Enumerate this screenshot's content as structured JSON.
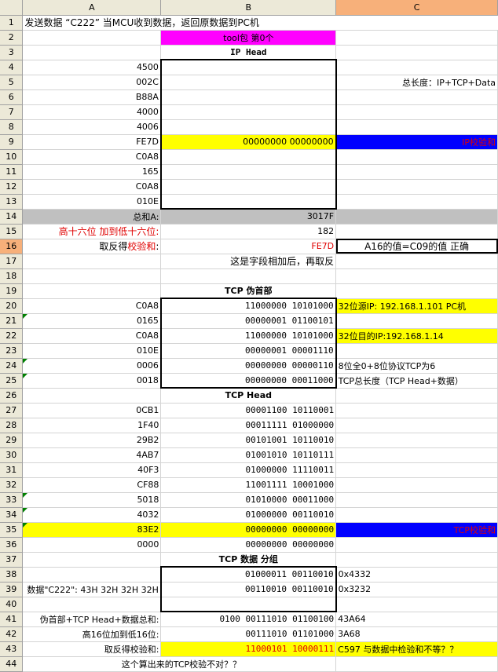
{
  "columns": [
    "A",
    "B",
    "C"
  ],
  "rows": {
    "r1": {
      "n": "1",
      "a": "发送数据 “C222” 当MCU收到数据，返回原数据到PC机"
    },
    "r2": {
      "n": "2",
      "b": "tool包 第0个"
    },
    "r3": {
      "n": "3",
      "b": "IP Head"
    },
    "r4": {
      "n": "4",
      "a": "4500"
    },
    "r5": {
      "n": "5",
      "a": "002C",
      "c": "总长度：IP+TCP+Data"
    },
    "r6": {
      "n": "6",
      "a": "B88A"
    },
    "r7": {
      "n": "7",
      "a": "4000"
    },
    "r8": {
      "n": "8",
      "a": "4006"
    },
    "r9": {
      "n": "9",
      "a": "FE7D",
      "b": "00000000 00000000",
      "c": "IP校验和"
    },
    "r10": {
      "n": "10",
      "a": "C0A8"
    },
    "r11": {
      "n": "11",
      "a": "165"
    },
    "r12": {
      "n": "12",
      "a": "C0A8"
    },
    "r13": {
      "n": "13",
      "a": "010E"
    },
    "r14": {
      "n": "14",
      "a": "总和A:",
      "b": "3017F"
    },
    "r15": {
      "n": "15",
      "a": "高十六位 加到低十六位:",
      "b": "182"
    },
    "r16": {
      "n": "16",
      "a1": "取反得",
      "a2": "校验和",
      "a3": ":",
      "b": "FE7D",
      "c": "A16的值=C09的值 正确"
    },
    "r17": {
      "n": "17",
      "b": "这是字段相加后，再取反"
    },
    "r18": {
      "n": "18"
    },
    "r19": {
      "n": "19",
      "b": "TCP 伪首部"
    },
    "r20": {
      "n": "20",
      "a": "C0A8",
      "b": "11000000 10101000",
      "c": "32位源IP: 192.168.1.101 PC机"
    },
    "r21": {
      "n": "21",
      "a": "0165",
      "b": "00000001 01100101"
    },
    "r22": {
      "n": "22",
      "a": "C0A8",
      "b": "11000000 10101000",
      "c": "32位目的IP:192.168.1.14"
    },
    "r23": {
      "n": "23",
      "a": "010E",
      "b": "00000001 00001110"
    },
    "r24": {
      "n": "24",
      "a": "0006",
      "b": "00000000 00000110",
      "c": "8位全0+8位协议TCP为6"
    },
    "r25": {
      "n": "25",
      "a": "0018",
      "b": "00000000 00011000",
      "c": "TCP总长度（TCP Head+数据）"
    },
    "r26": {
      "n": "26",
      "b": "TCP Head"
    },
    "r27": {
      "n": "27",
      "a": "0CB1",
      "b": "00001100 10110001"
    },
    "r28": {
      "n": "28",
      "a": "1F40",
      "b": "00011111 01000000"
    },
    "r29": {
      "n": "29",
      "a": "29B2",
      "b": "00101001 10110010"
    },
    "r30": {
      "n": "30",
      "a": "4AB7",
      "b": "01001010 10110111"
    },
    "r31": {
      "n": "31",
      "a": "40F3",
      "b": "01000000 11110011"
    },
    "r32": {
      "n": "32",
      "a": "CF88",
      "b": "11001111 10001000"
    },
    "r33": {
      "n": "33",
      "a": "5018",
      "b": "01010000 00011000"
    },
    "r34": {
      "n": "34",
      "a": "4032",
      "b": "01000000 00110010"
    },
    "r35": {
      "n": "35",
      "a": "83E2",
      "b": "00000000 00000000",
      "c": "TCP校验和"
    },
    "r36": {
      "n": "36",
      "a": "0000",
      "b": "00000000 00000000"
    },
    "r37": {
      "n": "37",
      "b": "TCP 数据 分组"
    },
    "r38": {
      "n": "38",
      "b": "01000011 00110010",
      "c": "0x4332"
    },
    "r39": {
      "n": "39",
      "a": "数据\"C222\": 43H 32H 32H 32H",
      "b": "00110010 00110010",
      "c": "0x3232"
    },
    "r40": {
      "n": "40"
    },
    "r41": {
      "n": "41",
      "a": "伪首部+TCP Head+数据总和:",
      "b": "0100 00111010 01100100",
      "c": "43A64"
    },
    "r42": {
      "n": "42",
      "a": "高16位加到低16位:",
      "b": "00111010 01101000",
      "c": "3A68"
    },
    "r43": {
      "n": "43",
      "a": "取反得校验和:",
      "b": "11000101 10000111",
      "c": "C597 与数据中检验和不等？？"
    },
    "r44": {
      "n": "44",
      "a": "这个算出来的TCP校验不对？？"
    }
  }
}
